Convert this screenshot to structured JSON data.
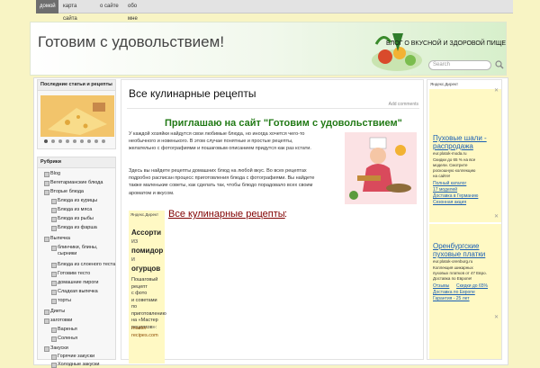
{
  "nav": {
    "items": [
      "домой",
      "карта сайта",
      "о сайте",
      "обо мне"
    ]
  },
  "header": {
    "site_title": "Готовим с удовольствием!",
    "slogan": "БЛОГ О ВКУСНОЙ И ЗДОРОВОЙ ПИЩЕ",
    "search_placeholder": "Search"
  },
  "sidebar": {
    "recent_title": "Последние статьи и рецепты",
    "rubrics_title": "Рубрики",
    "rubrics": [
      "Blog",
      "Вегетарианские блюда",
      "Вторые блюда",
      "Блюда из курицы",
      "Блюда из мяса",
      "Блюда из рыбы",
      "Блюда из фарша",
      "Выпечка",
      "блинчики, блины, сырники",
      "Блюда из слоеного теста",
      "Готовим тесто",
      "домашние пироги",
      "Сладкая выпечка",
      "торты",
      "Диеты",
      "заготовки",
      "Варенья",
      "Соленья",
      "Закуски",
      "Горячие закуски",
      "Холодные закуски"
    ]
  },
  "post": {
    "title": "Все кулинарные рецепты",
    "comments": "Add comments",
    "invite": "Приглашаю на сайт \"Готовим с удовольствием\"",
    "para1": [
      "У каждой хозяйки найдутся свои любимые блюда, но иногда хочется чего-то",
      "необычного и новенького. В этом случае понятные и простые рецепты,",
      "желательно с фотографиями и пошаговым описанием придутся как раз кстати."
    ],
    "para2": [
      "Здесь вы найдете рецепты домашних блюд на любой вкус. Во всех рецептах",
      "подробно расписан процесс приготовления блюда с фотографиями. Вы найдете",
      "также маленькие советы, как сделать так, чтобы блюдо порадовало всех своим",
      "ароматом и вкусом."
    ],
    "all_recipes": "Все кулинарные рецепты",
    "colon": ":"
  },
  "ad_left": {
    "label": "Яндекс.Директ",
    "h1": "Ассорти",
    "w1": "из",
    "h2": "помидор",
    "w2": "и",
    "h3": "огурцов",
    "text": [
      "Пошаговый",
      "рецепт",
      "с фото",
      "и советами",
      "по приготовлению",
      "на «Мастер",
      "рецептов»:"
    ],
    "url1": "master-",
    "url2": "recipes.com"
  },
  "ad_right": {
    "label": "Яндекс.Директ",
    "ad1": {
      "title": [
        "Пуховые шали -",
        "распродажа"
      ],
      "url": "eur.platok-moda.ru",
      "text": [
        "Скидки до 65 % на все",
        "модели. Смотрите",
        "роскошную коллекцию",
        "на сайте!"
      ],
      "links": [
        "Полный каталог",
        "17 моделей",
        "Доставка в Германию",
        "Сезонная акция"
      ]
    },
    "ad2": {
      "title": [
        "Оренбургские",
        "пуховые платки"
      ],
      "url": "eur.platok-orenburg.ru",
      "text": [
        "Коллекция шикарных",
        "пуховых платков от 47 Евро.",
        "Доставка по Европе!"
      ],
      "links": [
        "Отзывы",
        "Скидки до 65%",
        "Доставка по Европе",
        "Гарантия - 25 лет"
      ]
    },
    "close": "✕"
  },
  "colors": {
    "accent_green": "#227a16",
    "link_red": "#800000",
    "ad_bg": "#fff9c4",
    "page_bg": "#f8f4c4"
  }
}
